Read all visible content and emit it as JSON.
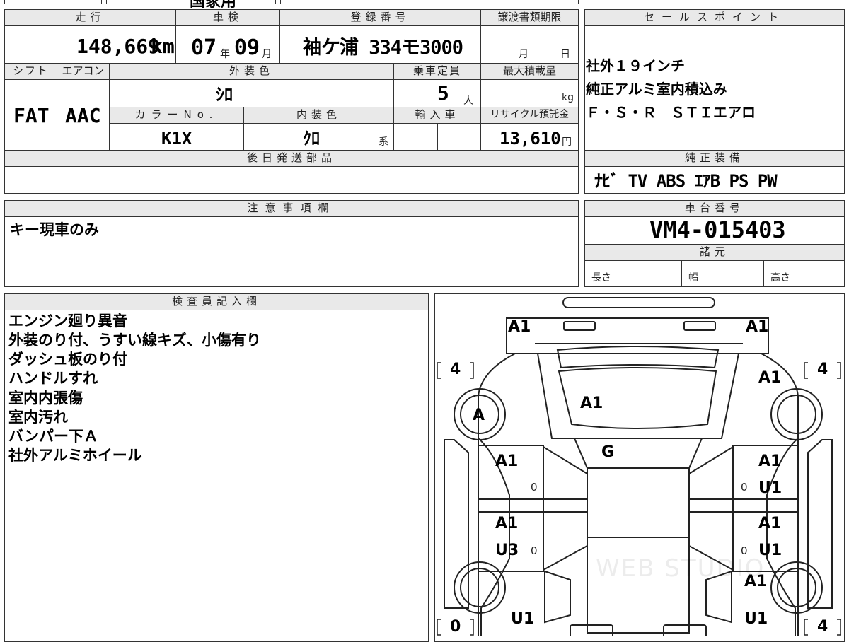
{
  "top_strip": {
    "partial_text": "国家用"
  },
  "vehicle": {
    "mileage_header": "走行",
    "mileage": "148,669",
    "mileage_unit": "km",
    "inspection_header": "車検",
    "inspection_year": "07",
    "year_unit": "年",
    "inspection_month": "09",
    "month_unit": "月",
    "registration_header": "登録番号",
    "registration": "袖ケ浦 334モ3000",
    "transfer_header": "譲渡書類期限",
    "transfer_month": "月",
    "transfer_day": "日",
    "shift_header": "シフト",
    "shift": "FAT",
    "ac_header": "エアコン",
    "ac": "AAC",
    "exterior_color_header": "外装色",
    "exterior_color": "ｼﾛ",
    "capacity_header": "乗車定員",
    "capacity": "5",
    "capacity_unit": "人",
    "max_load_header": "最大積載量",
    "max_load_unit": "kg",
    "color_no_header": "カラーNo.",
    "color_no": "K1X",
    "interior_color_header": "内装色",
    "interior_color": "ｸﾛ",
    "interior_color_unit": "系",
    "import_header": "輸入車",
    "recycle_header": "リサイクル預託金",
    "recycle_fee": "13,610",
    "recycle_unit": "円",
    "later_parts_header": "後日発送部品"
  },
  "sales_points": {
    "header": "セールスポイント",
    "lines": [
      "社外１９インチ",
      "純正アルミ室内積込み",
      "Ｆ・Ｓ・Ｒ　ＳＴＩエアロ"
    ]
  },
  "standard_equipment": {
    "header": "純正装備",
    "text": "ﾅﾋﾞ TV ABS ｴｱB PS PW"
  },
  "notes": {
    "header": "注意事項欄",
    "text": "キー現車のみ"
  },
  "chassis": {
    "header": "車台番号",
    "number": "VM4-015403",
    "specs_header": "諸元",
    "length_label": "長さ",
    "width_label": "幅",
    "height_label": "高さ"
  },
  "inspector": {
    "header": "検査員記入欄",
    "lines": [
      "エンジン廻り異音",
      "外装のり付、うすい線キズ、小傷有り",
      "ダッシュ板のり付",
      "ハンドルすれ",
      "室内内張傷",
      "室内汚れ",
      "バンパー下Ａ",
      "社外アルミホイール"
    ]
  },
  "diagram": {
    "marks": {
      "fl_bumper": "A1",
      "fr_bumper": "A1",
      "hood_right": "A1",
      "hood": "A1",
      "front_wheel_left": "A",
      "windshield": "G",
      "left_front_door": "A1",
      "right_front_door_1": "A1",
      "right_front_door_2": "U1",
      "left_rear_door_1": "A1",
      "left_rear_door_2": "U3",
      "right_rear_door_1": "A1",
      "right_rear_door_2": "U1",
      "rear_right_wheel": "A1",
      "rear_left_quarter": "U1",
      "rear_right_quarter": "U1",
      "tread_fl": "4",
      "tread_fr": "4",
      "tread_rl": "0",
      "tread_rr": "4",
      "ldoor_small_1": "0",
      "ldoor_small_2": "0",
      "rdoor_small_1": "0",
      "rdoor_small_2": "0"
    },
    "watermark": "WEB STUDIO"
  }
}
